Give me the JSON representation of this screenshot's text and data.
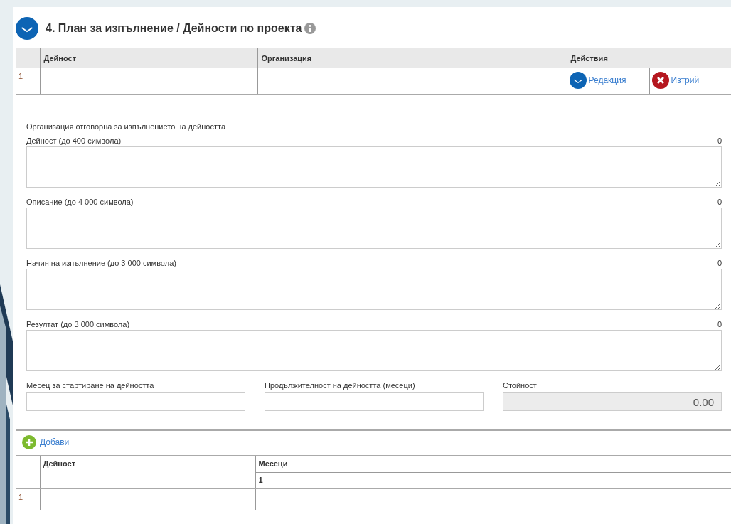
{
  "section": {
    "title": "4. План за изпълнение / Дейности по проекта"
  },
  "activities_table": {
    "columns": [
      "Дейност",
      "Организация",
      "Действия"
    ],
    "rows": [
      {
        "number": "1",
        "actions": [
          {
            "kind": "edit",
            "label": "Редакция"
          },
          {
            "kind": "delete",
            "label": "Изтрий"
          }
        ]
      }
    ]
  },
  "form": {
    "intro": "Организация отговорна за изпълнението на дейността",
    "text_areas": [
      {
        "label": "Дейност (до 400 символа)",
        "count": "0"
      },
      {
        "label": "Описание (до 4 000 символа)",
        "count": "0"
      },
      {
        "label": "Начин на изпълнение (до 3 000 символа)",
        "count": "0"
      },
      {
        "label": "Резултат (до 3 000 символа)",
        "count": "0"
      }
    ],
    "fields": [
      {
        "label": "Месец за стартиране на дейността",
        "disabled": false
      },
      {
        "label": "Продължителност на дейността (месеци)",
        "disabled": false
      },
      {
        "label": "Стойност",
        "value": "0.00",
        "disabled": true
      }
    ]
  },
  "add_button": "Добави",
  "schedule_table": {
    "columns": [
      "Дейност",
      "Месеци"
    ],
    "month_columns": [
      "1"
    ],
    "rows": [
      {
        "number": "1"
      }
    ]
  }
}
